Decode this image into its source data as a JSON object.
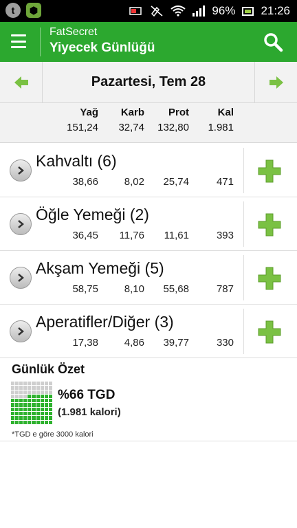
{
  "status_bar": {
    "battery": "96%",
    "time": "21:26",
    "notification_icons": [
      "tapatalk-icon",
      "app-icon"
    ]
  },
  "header": {
    "app_name": "FatSecret",
    "title": "Yiyecek Günlüğü"
  },
  "date_nav": {
    "date": "Pazartesi, Tem 28"
  },
  "totals": {
    "headers": [
      "Yağ",
      "Karb",
      "Prot",
      "Kal"
    ],
    "values": [
      "151,24",
      "32,74",
      "132,80",
      "1.981"
    ]
  },
  "meals": [
    {
      "name": "Kahvaltı (6)",
      "values": [
        "38,66",
        "8,02",
        "25,74",
        "471"
      ]
    },
    {
      "name": "Öğle Yemeği (2)",
      "values": [
        "36,45",
        "11,76",
        "11,61",
        "393"
      ]
    },
    {
      "name": "Akşam Yemeği (5)",
      "values": [
        "58,75",
        "8,10",
        "55,68",
        "787"
      ]
    },
    {
      "name": "Aperatifler/Diğer (3)",
      "values": [
        "17,38",
        "4,86",
        "39,77",
        "330"
      ]
    }
  ],
  "summary": {
    "title": "Günlük Özet",
    "percent": "%66 TGD",
    "calories": "(1.981 kalori)",
    "rdi_fraction": 0.66,
    "footnote": "*TGD e göre 3000 kalori"
  },
  "colors": {
    "primary_green": "#2ca82f",
    "accent_green": "#7ac143",
    "grid_empty": "#cfcfcf"
  }
}
